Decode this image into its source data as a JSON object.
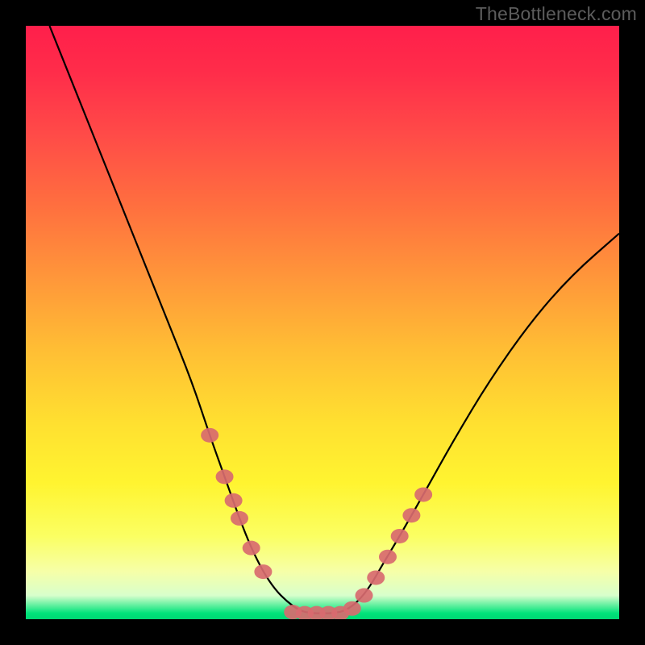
{
  "watermark": "TheBottleneck.com",
  "chart_data": {
    "type": "line",
    "title": "",
    "xlabel": "",
    "ylabel": "",
    "xlim": [
      0,
      100
    ],
    "ylim": [
      0,
      100
    ],
    "curve": {
      "x": [
        4,
        8,
        12,
        16,
        20,
        24,
        28,
        31,
        33.5,
        36,
        38,
        40,
        42,
        44,
        46,
        48,
        50,
        52,
        54,
        56,
        58,
        60,
        63,
        67,
        72,
        78,
        85,
        92,
        100
      ],
      "y": [
        100,
        90,
        80,
        70,
        60,
        50,
        40,
        31,
        24,
        17,
        12,
        8,
        5,
        3,
        1.5,
        1,
        1,
        1,
        1.5,
        3,
        5.5,
        9,
        14,
        21,
        30,
        40,
        50,
        58,
        65
      ]
    },
    "markers": {
      "x": [
        31,
        33.5,
        35,
        36,
        38,
        40,
        45,
        47,
        49,
        51,
        53,
        55,
        57,
        59,
        61,
        63,
        65,
        67
      ],
      "y": [
        31,
        24,
        20,
        17,
        12,
        8,
        1.2,
        1,
        1,
        1,
        1,
        1.8,
        4,
        7,
        10.5,
        14,
        17.5,
        21
      ]
    },
    "gradient_stops": [
      {
        "pos": 0,
        "color": "#ff1f4b"
      },
      {
        "pos": 18,
        "color": "#ff4a48"
      },
      {
        "pos": 42,
        "color": "#ff953a"
      },
      {
        "pos": 67,
        "color": "#ffe030"
      },
      {
        "pos": 92,
        "color": "#f6ffa8"
      },
      {
        "pos": 100,
        "color": "#00d873"
      }
    ],
    "marker_color": "#d86a6f",
    "curve_color": "#000000"
  }
}
